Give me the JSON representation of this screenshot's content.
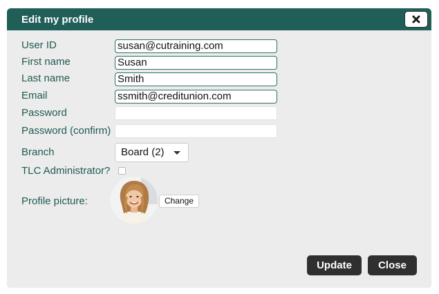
{
  "dialog": {
    "title": "Edit my profile",
    "close_icon": "close-x-icon"
  },
  "form": {
    "user_id": {
      "label": "User ID",
      "value": "susan@cutraining.com"
    },
    "first_name": {
      "label": "First name",
      "value": "Susan"
    },
    "last_name": {
      "label": "Last name",
      "value": "Smith"
    },
    "email": {
      "label": "Email",
      "value": "ssmith@creditunion.com"
    },
    "password": {
      "label": "Password",
      "value": ""
    },
    "password_confirm": {
      "label": "Password (confirm)",
      "value": ""
    },
    "branch": {
      "label": "Branch",
      "selected": "Board (2)"
    },
    "tlc_admin": {
      "label": "TLC Administrator?",
      "checked": false
    },
    "profile_picture": {
      "label": "Profile picture:",
      "change_label": "Change"
    }
  },
  "actions": {
    "update_label": "Update",
    "close_label": "Close"
  },
  "colors": {
    "titlebar": "#1f5f57",
    "label_text": "#1f5a52",
    "field_border": "#2f6e65",
    "dialog_bg": "#ececec",
    "button_bg": "#2f2f2f"
  }
}
